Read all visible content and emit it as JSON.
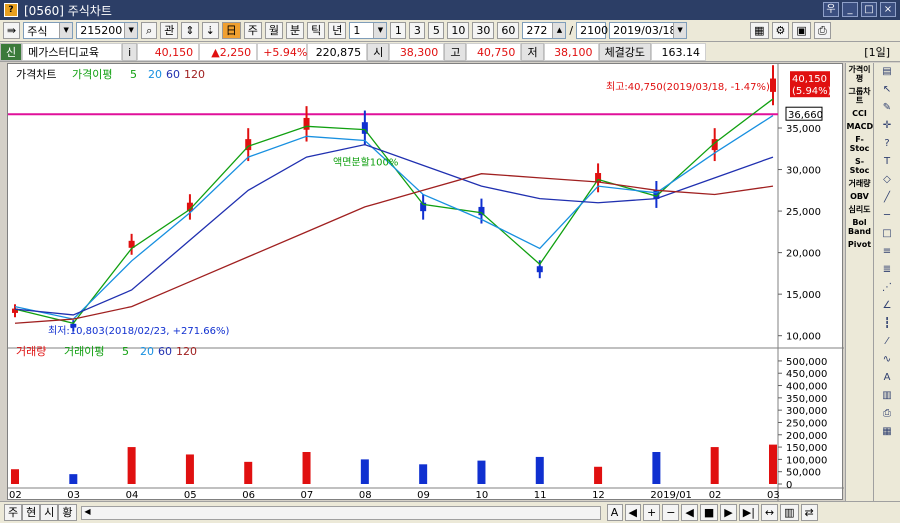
{
  "window": {
    "title": "[0560] 주식차트",
    "btn_pin": "우",
    "btn_min": "_",
    "btn_max": "□",
    "btn_close": "×",
    "help": "?"
  },
  "toolbar": {
    "market": "주식",
    "code": "215200",
    "search_icon": "search-icon",
    "tab_gwan": "관",
    "period_buttons": [
      "주",
      "월",
      "분",
      "틱",
      "년"
    ],
    "period_value": "1",
    "quick_buttons": [
      "1",
      "3",
      "5",
      "10",
      "30",
      "60"
    ],
    "count": "272",
    "count_sep": "/",
    "total": "2100",
    "date": "2019/03/18"
  },
  "quote": {
    "badge": "신",
    "name": "메가스터디교육",
    "info": "i",
    "price": "40,150",
    "change": "▲2,250",
    "change_pct": "+5.94%",
    "volume": "220,875",
    "open_lbl": "시",
    "open": "38,300",
    "high_lbl": "고",
    "high": "40,750",
    "low_lbl": "저",
    "low": "38,100",
    "strength_lbl": "체결강도",
    "strength": "163.14",
    "period_tag": "[1일]"
  },
  "price_panel": {
    "legend_title": "가격차트",
    "legend_ma": "가격이평",
    "ma_periods": [
      "5",
      "20",
      "60",
      "120"
    ],
    "ma_colors": [
      "#10a010",
      "#1890e0",
      "#2030b0",
      "#a02020"
    ],
    "y_ticks": [
      "35,000",
      "30,000",
      "25,000",
      "20,000",
      "15,000",
      "10,000"
    ],
    "current_price_box": "40,150",
    "current_pct_box": "(5.94%)",
    "hline_label": "36,660",
    "max_annotation": "최고:40,750(2019/03/18, -1.47%)",
    "min_annotation": "최저:10,803(2018/02/23, +271.66%)",
    "mid_annotation": "액면분할100%"
  },
  "volume_panel": {
    "legend_title": "거래량",
    "legend_ma": "거래이평",
    "ma_periods": [
      "5",
      "20",
      "60",
      "120"
    ],
    "y_ticks": [
      "500,000",
      "450,000",
      "400,000",
      "350,000",
      "300,000",
      "250,000",
      "200,000",
      "150,000",
      "100,000",
      "50,000",
      "0"
    ]
  },
  "x_axis": {
    "labels": [
      "02",
      "03",
      "04",
      "05",
      "06",
      "07",
      "08",
      "09",
      "10",
      "11",
      "12",
      "2019/01",
      "02",
      "03"
    ]
  },
  "sidebar": {
    "indicators": [
      "가격이평",
      "그룹차트",
      "CCI",
      "MACD",
      "F-Stoc",
      "S-Stoc",
      "거래량",
      "OBV",
      "심리도",
      "Bol Band",
      "Pivot"
    ]
  },
  "bottom": {
    "tabs": [
      "주",
      "현",
      "시",
      "황"
    ]
  },
  "chart_data": {
    "type": "line",
    "title": "가격차트",
    "y_range": [
      9000,
      41500
    ],
    "annotations": {
      "max": 40750,
      "min": 10803,
      "hline": 36660,
      "last": 40150
    },
    "x": [
      "2018-02",
      "2018-03",
      "2018-04",
      "2018-05",
      "2018-06",
      "2018-07",
      "2018-08",
      "2018-09",
      "2018-10",
      "2018-11",
      "2018-12",
      "2019-01",
      "2019-02",
      "2019-03"
    ],
    "series": [
      {
        "name": "가격",
        "values": [
          13000,
          11200,
          21000,
          25500,
          33000,
          35500,
          35000,
          25500,
          25000,
          18000,
          29000,
          27000,
          33000,
          40150
        ]
      },
      {
        "name": "5",
        "values": [
          13200,
          11500,
          20500,
          25200,
          32800,
          35200,
          34800,
          25800,
          24800,
          18600,
          28800,
          26800,
          33200,
          38500
        ]
      },
      {
        "name": "20",
        "values": [
          13500,
          12000,
          19000,
          24800,
          31500,
          34000,
          33500,
          27000,
          24000,
          20500,
          28000,
          27200,
          32000,
          36500
        ]
      },
      {
        "name": "60",
        "values": [
          13200,
          12500,
          15500,
          21500,
          27500,
          31500,
          33000,
          30500,
          28000,
          26500,
          26000,
          26500,
          29000,
          31500
        ]
      },
      {
        "name": "120",
        "values": [
          11500,
          12000,
          13500,
          16500,
          19500,
          22500,
          25500,
          27500,
          29500,
          29000,
          28500,
          27500,
          27000,
          28000
        ]
      }
    ],
    "volume": [
      60000,
      40000,
      150000,
      120000,
      90000,
      130000,
      100000,
      80000,
      95000,
      110000,
      70000,
      130000,
      150000,
      160000
    ]
  }
}
